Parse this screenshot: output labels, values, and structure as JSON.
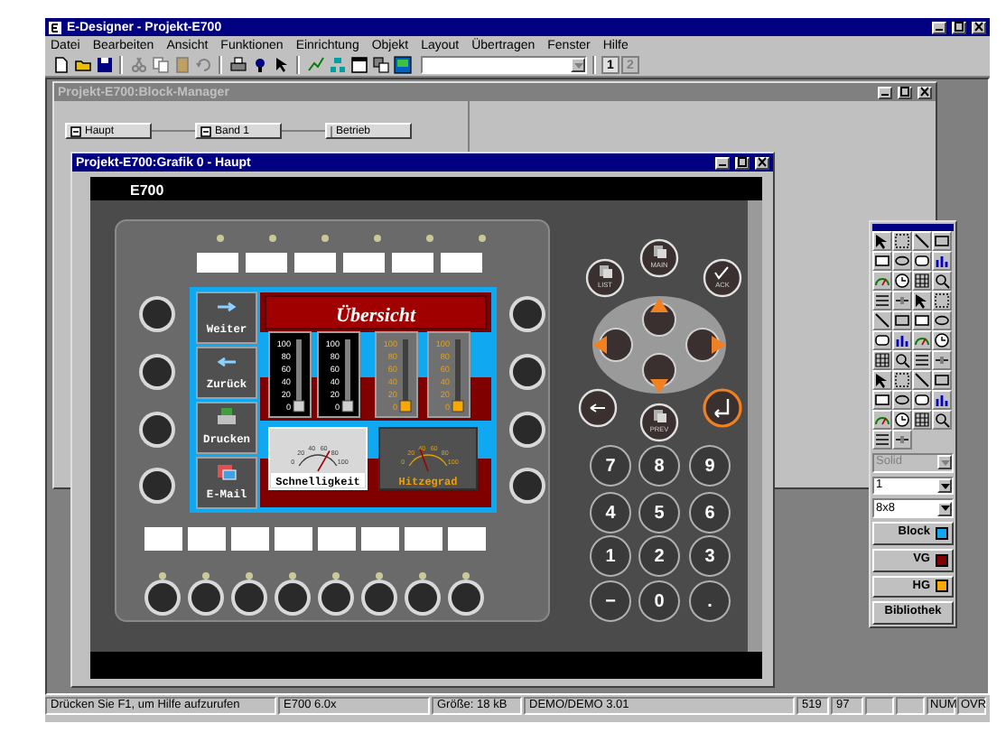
{
  "window": {
    "title": "E-Designer - Projekt-E700"
  },
  "menu": [
    {
      "label": "Datei"
    },
    {
      "label": "Bearbeiten"
    },
    {
      "label": "Ansicht"
    },
    {
      "label": "Funktionen"
    },
    {
      "label": "Einrichtung"
    },
    {
      "label": "Objekt"
    },
    {
      "label": "Layout"
    },
    {
      "label": "Übertragen"
    },
    {
      "label": "Fenster"
    },
    {
      "label": "Hilfe"
    }
  ],
  "toolbar": {
    "page_buttons": [
      {
        "label": "1",
        "disabled": false
      },
      {
        "label": "2",
        "disabled": true
      }
    ]
  },
  "block_manager": {
    "title": "Projekt-E700:Block-Manager",
    "active": false,
    "blocks": [
      {
        "label": "Haupt",
        "collapsible": true
      },
      {
        "label": "Band 1",
        "collapsible": true
      },
      {
        "label": "Betrieb",
        "collapsible": false
      }
    ]
  },
  "graphic_window": {
    "title": "Projekt-E700:Grafik 0 - Haupt",
    "active": true,
    "terminal": {
      "logo": "E700",
      "menu_buttons": [
        {
          "label": "Weiter"
        },
        {
          "label": "Zurück"
        },
        {
          "label": "Drucken"
        },
        {
          "label": "E-Mail"
        }
      ],
      "screen_title": "Übersicht",
      "bar_meters": [
        {
          "kind": "dark",
          "ticks": [
            "100",
            "80",
            "60",
            "40",
            "20",
            "0"
          ],
          "level": 0
        },
        {
          "kind": "dark",
          "ticks": [
            "100",
            "80",
            "60",
            "40",
            "20",
            "0"
          ],
          "level": 0
        },
        {
          "kind": "light",
          "ticks": [
            "100",
            "80",
            "60",
            "40",
            "20",
            "0"
          ],
          "level": 0
        },
        {
          "kind": "light",
          "ticks": [
            "100",
            "80",
            "60",
            "40",
            "20",
            "0"
          ],
          "level": 0
        }
      ],
      "dials": [
        {
          "kind": "light",
          "label": "Schnelligkeit",
          "scale": [
            "0",
            "20",
            "40",
            "60",
            "80",
            "100"
          ]
        },
        {
          "kind": "dark",
          "label": "Hitzegrad",
          "scale": [
            "0",
            "20",
            "40",
            "60",
            "80",
            "100"
          ]
        }
      ],
      "function_keys": [
        {
          "label": "LIST"
        },
        {
          "label": "MAIN"
        },
        {
          "label": "ACK"
        },
        {
          "label": "PREV"
        }
      ],
      "numeric_keys": [
        {
          "label": "7"
        },
        {
          "label": "8"
        },
        {
          "label": "9"
        },
        {
          "label": "4"
        },
        {
          "label": "5"
        },
        {
          "label": "6"
        },
        {
          "label": "1"
        },
        {
          "label": "2"
        },
        {
          "label": "3"
        },
        {
          "label": "−"
        },
        {
          "label": "0"
        },
        {
          "label": "."
        }
      ]
    }
  },
  "toolbox": {
    "line_style": {
      "value": "Solid",
      "disabled": true
    },
    "line_width": {
      "value": "1",
      "disabled": false
    },
    "grid": {
      "value": "8x8",
      "disabled": false
    },
    "color_buttons": [
      {
        "label": "Block",
        "color": "#10a8f0"
      },
      {
        "label": "VG",
        "color": "#800000"
      },
      {
        "label": "HG",
        "color": "#f8a800"
      }
    ],
    "library_button": "Bibliothek"
  },
  "status_bar": {
    "message": "Drücken Sie F1, um Hilfe aufzurufen",
    "panes": [
      "E700 6.0x",
      "Größe: 18 kB",
      "DEMO/DEMO 3.01",
      "519",
      "97"
    ],
    "indicators": [
      "NUM",
      "OVR"
    ]
  }
}
